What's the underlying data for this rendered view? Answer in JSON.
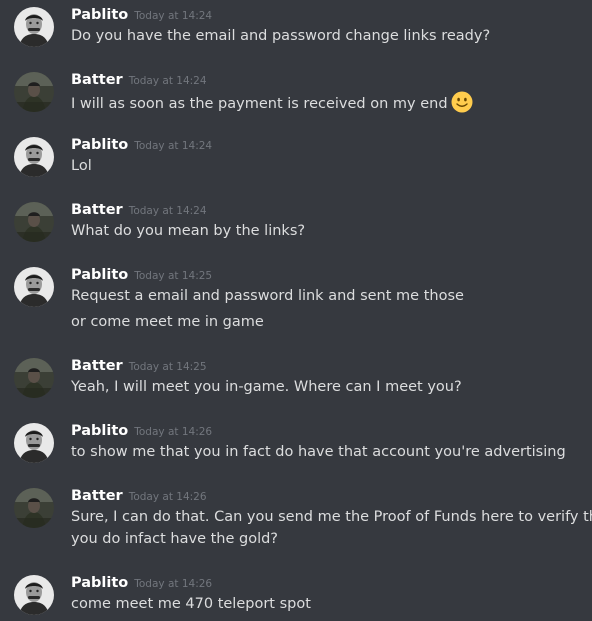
{
  "messages": [
    {
      "author": "Pablito",
      "timestamp": "Today at 14:24",
      "avatar": "pablito-avatar",
      "lines": [
        "Do you have the email and password change links ready?"
      ]
    },
    {
      "author": "Batter",
      "timestamp": "Today at 14:24",
      "avatar": "batter-avatar",
      "lines": [
        "I will as soon as the payment is received on my end"
      ],
      "emoji": "slightly-smiling-face-emoji"
    },
    {
      "author": "Pablito",
      "timestamp": "Today at 14:24",
      "avatar": "pablito-avatar",
      "lines": [
        "Lol"
      ]
    },
    {
      "author": "Batter",
      "timestamp": "Today at 14:24",
      "avatar": "batter-avatar",
      "lines": [
        "What do you mean by the links?"
      ]
    },
    {
      "author": "Pablito",
      "timestamp": "Today at 14:25",
      "avatar": "pablito-avatar",
      "lines": [
        "Request a email and password link and sent me those",
        "or come meet me in game"
      ]
    },
    {
      "author": "Batter",
      "timestamp": "Today at 14:25",
      "avatar": "batter-avatar",
      "lines": [
        "Yeah, I will meet you in-game. Where can I meet you?"
      ]
    },
    {
      "author": "Pablito",
      "timestamp": "Today at 14:26",
      "avatar": "pablito-avatar",
      "lines": [
        "to show me that you in fact do have that account you're advertising"
      ]
    },
    {
      "author": "Batter",
      "timestamp": "Today at 14:26",
      "avatar": "batter-avatar",
      "lines": [
        "Sure, I can do that. Can you send me the Proof of Funds here to verify that",
        "you do infact have the gold?"
      ]
    },
    {
      "author": "Pablito",
      "timestamp": "Today at 14:26",
      "avatar": "pablito-avatar",
      "lines": [
        "come meet me 470 teleport spot"
      ]
    }
  ],
  "colors": {
    "background": "#36393f",
    "author": "#ffffff",
    "timestamp": "#72767d",
    "text": "#dcddde"
  }
}
